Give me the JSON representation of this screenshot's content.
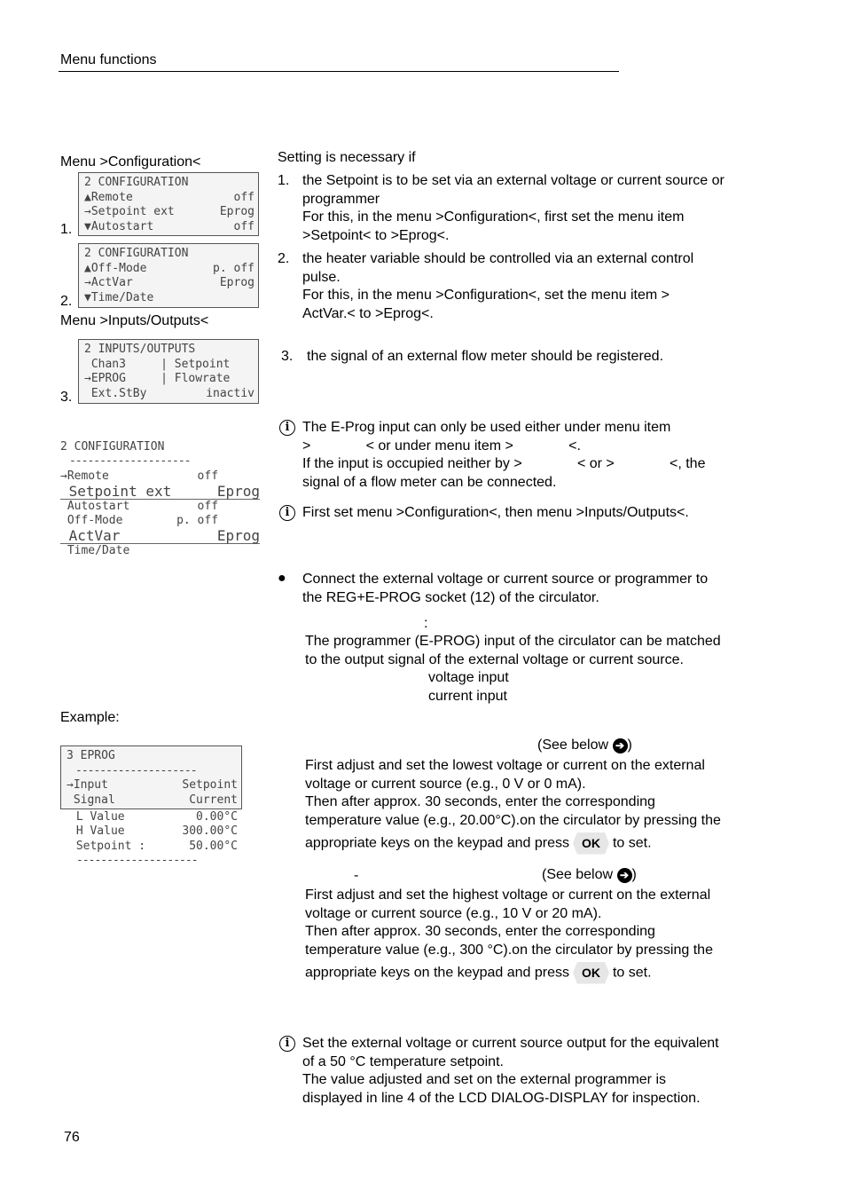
{
  "header": {
    "title": "Menu functions"
  },
  "left": {
    "menu_config_label": "Menu >Configuration<",
    "menu_io_label": "Menu >Inputs/Outputs<",
    "example_label": "Example:",
    "lcd1": {
      "number": "1.",
      "title": "2 CONFIGURATION",
      "rows": [
        {
          "left": "▲Remote",
          "right": "off"
        },
        {
          "left": "→Setpoint ext",
          "right": "Eprog"
        },
        {
          "left": "▼Autostart",
          "right": "off"
        }
      ]
    },
    "lcd2": {
      "number": "2.",
      "title": "2 CONFIGURATION",
      "rows": [
        {
          "left": "▲Off-Mode",
          "right": "p. off"
        },
        {
          "left": "→ActVar",
          "right": "Eprog"
        },
        {
          "left": "▼Time/Date",
          "right": ""
        }
      ]
    },
    "lcd3": {
      "number": "3.",
      "title": "2 INPUTS/OUTPUTS",
      "rows": [
        {
          "left": " Chan3     | Setpoint",
          "right": ""
        },
        {
          "left": "→EPROG     | Flowrate",
          "right": ""
        },
        {
          "left": " Ext.StBy",
          "right": "inactiv"
        }
      ]
    },
    "config_list": {
      "title": "2 CONFIGURATION",
      "divider": "--------------------",
      "rows": [
        {
          "left": "→Remote",
          "right": "off      "
        },
        {
          "left": " Setpoint ext",
          "right": "Eprog",
          "big": true
        },
        {
          "left": " Autostart",
          "right": "off      "
        },
        {
          "left": " Off-Mode",
          "right": "p. off      "
        },
        {
          "left": " ActVar",
          "right": "Eprog",
          "big": true
        },
        {
          "left": " Time/Date",
          "right": ""
        }
      ]
    },
    "eprog_lcd": {
      "title": "3 EPROG",
      "divider": "--------------------",
      "rows": [
        {
          "left": "→Input",
          "right": "Setpoint"
        },
        {
          "left": " Signal",
          "right": "Current"
        }
      ],
      "extra_rows": [
        {
          "left": " L Value",
          "right": "0.00°C"
        },
        {
          "left": " H Value",
          "right": "300.00°C"
        },
        {
          "left": " Setpoint :",
          "right": "50.00°C"
        }
      ],
      "bottom_divider": "--------------------"
    }
  },
  "right": {
    "intro": "Setting is necessary if",
    "items": [
      {
        "num": "1.",
        "lines": [
          "the Setpoint is to be set via an external voltage or current source or",
          "programmer",
          "For this, in the menu >Configuration<, first set the menu item",
          ">Setpoint< to >Eprog<."
        ]
      },
      {
        "num": "2.",
        "lines": [
          "the heater variable should be controlled via an external control",
          "pulse.",
          "For this, in the menu >Configuration<, set the menu item >",
          "ActVar.< to >Eprog<."
        ]
      },
      {
        "num": "3.",
        "lines": [
          "the signal of an external flow meter should be registered."
        ]
      }
    ],
    "note1": {
      "icon": "info-icon",
      "lines": [
        "The E-Prog input can only be used either under menu item",
        ">              < or under menu item >              <.",
        "If the input is occupied neither by >              < or >              <, the",
        "signal of a flow meter can be connected."
      ]
    },
    "note2": {
      "icon": "info-icon",
      "text": "First set menu >Configuration<, then menu >Inputs/Outputs<."
    },
    "bullet": {
      "icon": "bullet-icon",
      "lines": [
        "Connect the external voltage or current source or programmer to",
        "the REG+E-PROG socket (12) of the circulator."
      ]
    },
    "signal_colon": ":",
    "signal_lines": [
      "The programmer (E-PROG) input of the circulator can be matched",
      "to the output signal of the external voltage or current source."
    ],
    "signal_options": [
      "voltage input",
      "current input"
    ],
    "low_value": {
      "see_below": "(See below ",
      "see_below_close": ")",
      "lines": [
        "First adjust and set the lowest voltage or current on the external",
        "voltage or current source (e.g., 0 V or 0 mA).",
        "Then after approx. 30 seconds, enter the corresponding",
        "temperature value (e.g., 20.00°C).on the circulator by pressing the"
      ],
      "last_pre": "appropriate keys on the keypad and press",
      "ok": "OK",
      "last_post": "to set."
    },
    "high_value": {
      "dash": "-",
      "see_below": "(See below ",
      "see_below_close": ")",
      "lines": [
        "First adjust and set the highest voltage or current on the external",
        "voltage or current source (e.g., 10 V or 20 mA).",
        "Then after approx. 30 seconds, enter the corresponding",
        "temperature value (e.g., 300 °C).on the circulator by pressing the"
      ],
      "last_pre": "appropriate keys on the keypad and press",
      "ok": "OK",
      "last_post": "to set."
    },
    "note3": {
      "icon": "info-icon",
      "lines": [
        "Set the external voltage or current source output for the equivalent",
        "of a 50 °C temperature setpoint.",
        "The value adjusted and set on the external programmer is",
        "displayed in line 4 of the LCD DIALOG-DISPLAY for inspection."
      ]
    },
    "arrow_glyph": "➲"
  },
  "footer": {
    "page_number": "76"
  }
}
